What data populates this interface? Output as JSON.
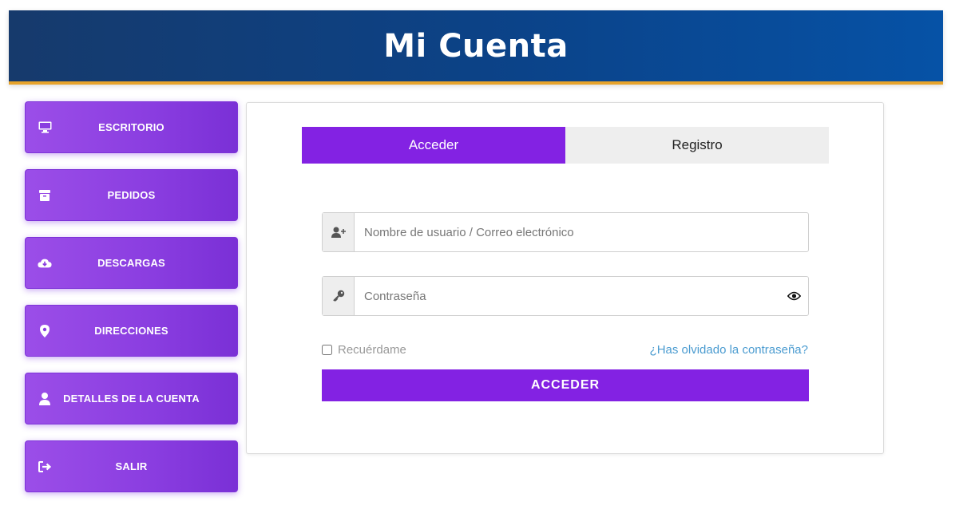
{
  "header": {
    "title": "Mi Cuenta"
  },
  "sidebar": {
    "items": [
      {
        "label": "ESCRITORIO",
        "icon": "monitor-icon"
      },
      {
        "label": "PEDIDOS",
        "icon": "box-icon"
      },
      {
        "label": "DESCARGAS",
        "icon": "cloud-download-icon"
      },
      {
        "label": "DIRECCIONES",
        "icon": "map-pin-icon"
      },
      {
        "label": "DETALLES DE LA CUENTA",
        "icon": "user-icon"
      },
      {
        "label": "SALIR",
        "icon": "logout-icon"
      }
    ]
  },
  "tabs": {
    "login": "Acceder",
    "register": "Registro"
  },
  "form": {
    "username_placeholder": "Nombre de usuario / Correo electrónico",
    "password_placeholder": "Contraseña",
    "remember_label": "Recuérdame",
    "forgot_link": "¿Has olvidado la contraseña?",
    "submit_label": "ACCEDER"
  },
  "colors": {
    "accent": "#8322e3",
    "header_start": "#163a6c",
    "header_end": "#0652a6",
    "header_border": "#e6a32b",
    "link": "#4a9bd0"
  }
}
